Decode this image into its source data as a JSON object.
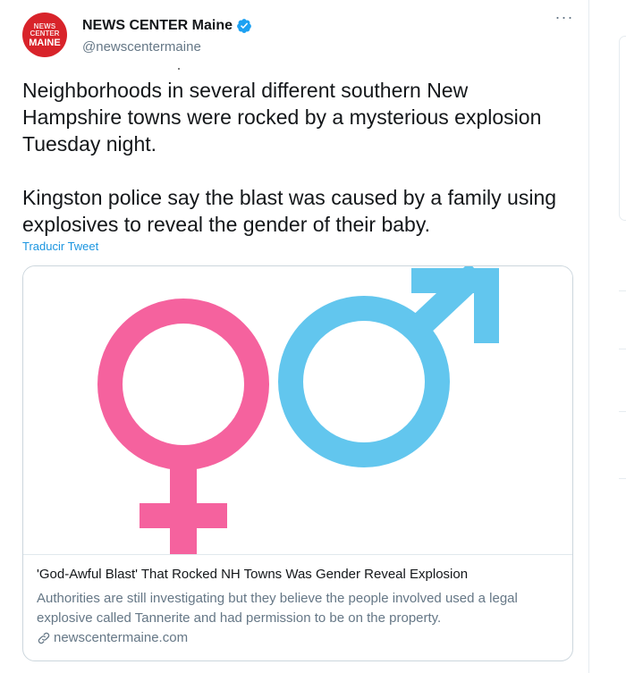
{
  "tweet": {
    "avatar_text": [
      "NEWS",
      "CENTER",
      "MAINE"
    ],
    "author_name": "NEWS CENTER Maine",
    "author_handle": "@newscentermaine",
    "verified": true,
    "more_icon": "more-horizontal-icon",
    "text_paragraphs": [
      "Neighborhoods in several different southern New Hampshire towns were rocked by a mysterious explosion Tuesday night.",
      "Kingston police say the blast was caused by a family using explosives to reveal the gender of their baby."
    ],
    "translate_label": "Traducir Tweet"
  },
  "card": {
    "image_icons": [
      "female-symbol-icon",
      "male-symbol-icon"
    ],
    "female_color": "#f5629e",
    "male_color": "#62c6ee",
    "title": "'God-Awful Blast' That Rocked NH Towns Was Gender Reveal Explosion",
    "description": "Authorities are still investigating but they believe the people involved used a legal explosive called Tannerite and had permission to be on the property.",
    "domain": "newscentermaine.com",
    "link_icon": "link-icon"
  },
  "colors": {
    "accent": "#1b95e0",
    "verified_badge": "#1da1f2",
    "text": "#14171a",
    "secondary_text": "#657786",
    "avatar_bg": "#d8232a"
  }
}
